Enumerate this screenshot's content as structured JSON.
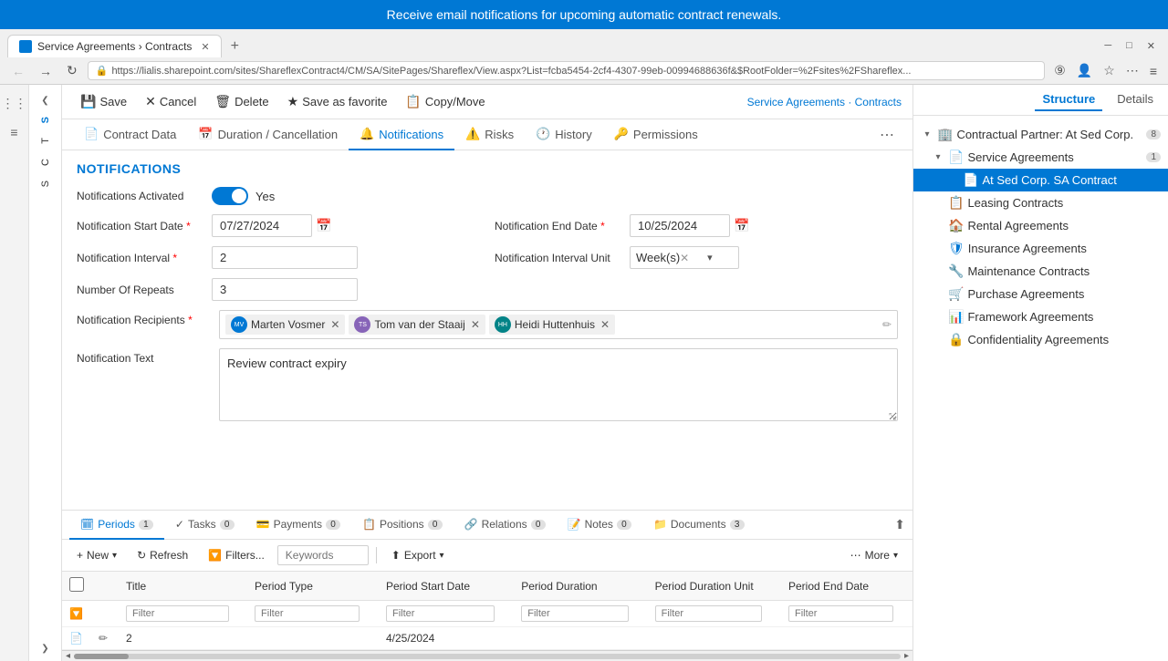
{
  "banner": {
    "text": "Receive email notifications for upcoming automatic contract renewals."
  },
  "browser": {
    "tab_label": "Service Agreements › Contracts",
    "url": "https://lialis.sharepoint.com/sites/ShareflexContract4/CM/SA/SitePages/Shareflex/View.aspx?List=fcba5454-2cf4-4307-99eb-00994688636f&$RootFolder=%2Fsites%2FShareflex...",
    "breadcrumb": "Service Agreements · Contracts"
  },
  "toolbar": {
    "save": "Save",
    "cancel": "Cancel",
    "delete": "Delete",
    "save_as_favorite": "Save as favorite",
    "copy_move": "Copy/Move",
    "structure": "Structure",
    "details": "Details"
  },
  "tabs": [
    {
      "id": "contract-data",
      "label": "Contract Data",
      "icon": "📄"
    },
    {
      "id": "duration",
      "label": "Duration / Cancellation",
      "icon": "📅"
    },
    {
      "id": "notifications",
      "label": "Notifications",
      "icon": "🔔",
      "active": true
    },
    {
      "id": "risks",
      "label": "Risks",
      "icon": "⚠️"
    },
    {
      "id": "history",
      "label": "History",
      "icon": "🕐"
    },
    {
      "id": "permissions",
      "label": "Permissions",
      "icon": "🔑"
    }
  ],
  "form": {
    "section_title": "NOTIFICATIONS",
    "notifications_activated_label": "Notifications Activated",
    "notifications_activated_value": "Yes",
    "toggle_on": true,
    "notification_start_date_label": "Notification Start Date",
    "notification_start_date_required": true,
    "notification_start_date_value": "07/27/2024",
    "notification_end_date_label": "Notification End Date",
    "notification_end_date_required": true,
    "notification_end_date_value": "10/25/2024",
    "notification_interval_label": "Notification Interval",
    "notification_interval_required": true,
    "notification_interval_value": "2",
    "notification_interval_unit_label": "Notification Interval Unit",
    "notification_interval_unit_value": "Week(s)",
    "number_of_repeats_label": "Number Of Repeats",
    "number_of_repeats_value": "3",
    "notification_recipients_label": "Notification Recipients",
    "notification_recipients_required": true,
    "recipients": [
      {
        "name": "Marten Vosmer",
        "initials": "MV"
      },
      {
        "name": "Tom van der Staaij",
        "initials": "TS"
      },
      {
        "name": "Heidi Huttenhuis",
        "initials": "HH"
      }
    ],
    "notification_text_label": "Notification Text",
    "notification_text_value": "Review contract expiry"
  },
  "bottom_tabs": [
    {
      "id": "periods",
      "label": "Periods",
      "count": "1",
      "icon": "🗓",
      "active": true
    },
    {
      "id": "tasks",
      "label": "Tasks",
      "count": "0",
      "icon": "✓"
    },
    {
      "id": "payments",
      "label": "Payments",
      "count": "0",
      "icon": "💳"
    },
    {
      "id": "positions",
      "label": "Positions",
      "count": "0",
      "icon": "📋"
    },
    {
      "id": "relations",
      "label": "Relations",
      "count": "0",
      "icon": "🔗"
    },
    {
      "id": "notes",
      "label": "Notes",
      "count": "0",
      "icon": "📝"
    },
    {
      "id": "documents",
      "label": "Documents",
      "count": "3",
      "icon": "📁"
    }
  ],
  "table": {
    "columns": [
      "Title",
      "Period Type",
      "Period Start Date",
      "Period Duration",
      "Period Duration Unit",
      "Period End Date"
    ],
    "filter_placeholder": "Filter",
    "rows": [
      {
        "col1": "2",
        "col2": "",
        "col3": "4/25/2024",
        "col4": "",
        "col5": "",
        "col6": ""
      }
    ]
  },
  "toolbar_bottom": {
    "new": "New",
    "refresh": "Refresh",
    "filters": "Filters...",
    "keywords_placeholder": "Keywords",
    "export": "Export",
    "more": "More"
  },
  "right_panel": {
    "tab_structure": "Structure",
    "tab_details": "Details",
    "tree": {
      "root": {
        "label": "Contractual Partner: At Sed Corp.",
        "badge": "8",
        "icon": "🏢"
      },
      "service_agreements": {
        "label": "Service Agreements",
        "badge": "1",
        "icon": "📄"
      },
      "active_contract": {
        "label": "At Sed Corp. SA Contract",
        "icon": "📄"
      },
      "items": [
        {
          "label": "Leasing Contracts",
          "icon": "📋"
        },
        {
          "label": "Rental Agreements",
          "icon": "🏠"
        },
        {
          "label": "Insurance Agreements",
          "icon": "🛡"
        },
        {
          "label": "Maintenance Contracts",
          "icon": "🔧"
        },
        {
          "label": "Purchase Agreements",
          "icon": "🛒"
        },
        {
          "label": "Framework Agreements",
          "icon": "📊"
        },
        {
          "label": "Confidentiality Agreements",
          "icon": "🔒"
        }
      ]
    }
  },
  "sf_sidebar": {
    "items": [
      "S",
      "T",
      "C",
      "S"
    ]
  }
}
